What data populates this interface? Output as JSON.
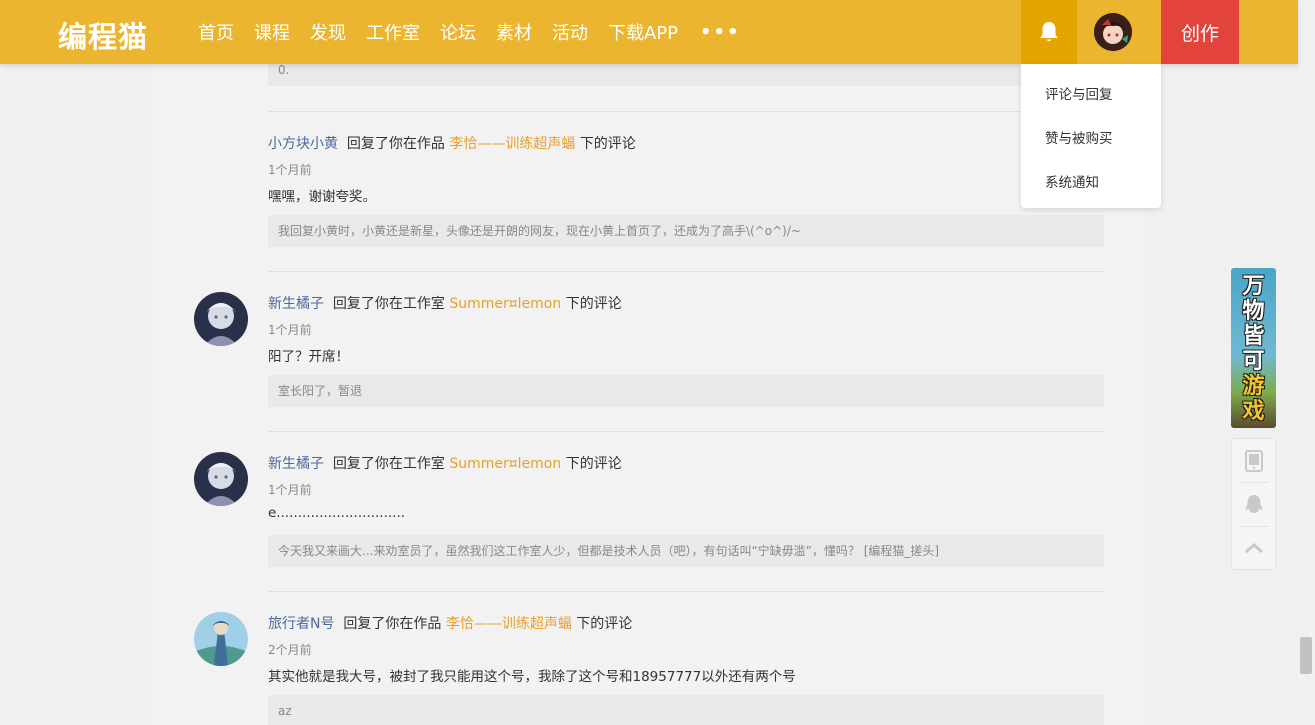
{
  "header": {
    "logo": "编程猫",
    "nav": [
      "首页",
      "课程",
      "发现",
      "工作室",
      "论坛",
      "素材",
      "活动",
      "下载APP"
    ],
    "more": "•••",
    "create_label": "创作"
  },
  "dropdown": {
    "items": [
      "评论与回复",
      "赞与被购买",
      "系统通知"
    ]
  },
  "threads": [
    {
      "prev_quote": "0.",
      "user": "小方块小黄",
      "action": "回复了你在作品",
      "target": "李恰——训练超声蝠",
      "suffix": "下的评论",
      "time": "1个月前",
      "content": "嘿嘿，谢谢夸奖。",
      "quote": "我回复小黄时，小黄还是新星，头像还是开朗的网友，现在小黄上首页了，还成为了高手\\(^o^)/~"
    },
    {
      "user": "新生橘子",
      "action": "回复了你在工作室",
      "target": "Summer¤lemon",
      "suffix": "下的评论",
      "time": "1个月前",
      "content": "阳了？开席！",
      "quote": "室长阳了，暂退"
    },
    {
      "user": "新生橘子",
      "action": "回复了你在工作室",
      "target": "Summer¤lemon",
      "suffix": "下的评论",
      "time": "1个月前",
      "content": "e..............................",
      "quote": "今天我又来画大...来劝室员了，虽然我们这工作室人少，但都是技术人员（吧），有句话叫“宁缺毋滥”，懂吗？ [编程猫_搓头]"
    },
    {
      "user": "旅行者N号",
      "action": "回复了你在作品",
      "target": "李恰——训练超声蝠",
      "suffix": "下的评论",
      "time": "2个月前",
      "content": "其实他就是我大号，被封了我只能用这个号，我除了这个号和18957777以外还有两个号",
      "quote": "az"
    }
  ],
  "banner": {
    "line1": "万物皆可",
    "line2": "游戏"
  },
  "colors": {
    "header": "#ecb52f",
    "bell_active": "#e6a400",
    "create": "#e2433d",
    "user_link": "#4a6a9c",
    "target_link": "#e8a02a"
  }
}
